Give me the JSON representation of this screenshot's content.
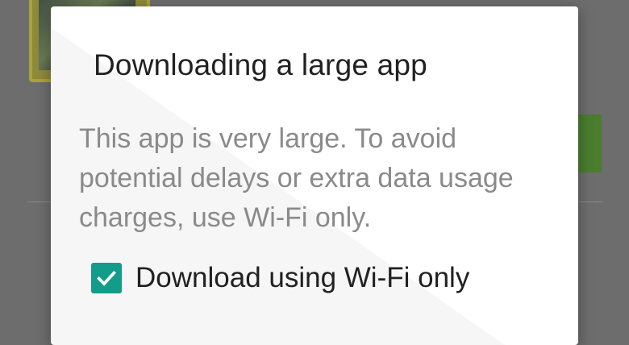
{
  "dialog": {
    "title": "Downloading a large app",
    "message": "This app is very large. To avoid potential delays or extra data usage charges, use Wi-Fi only.",
    "checkbox": {
      "label": "Download using Wi-Fi only",
      "checked": true,
      "color": "#139c89"
    }
  },
  "background": {
    "icons": [
      "app-icon"
    ],
    "accent_color": "#4a7d2e"
  }
}
